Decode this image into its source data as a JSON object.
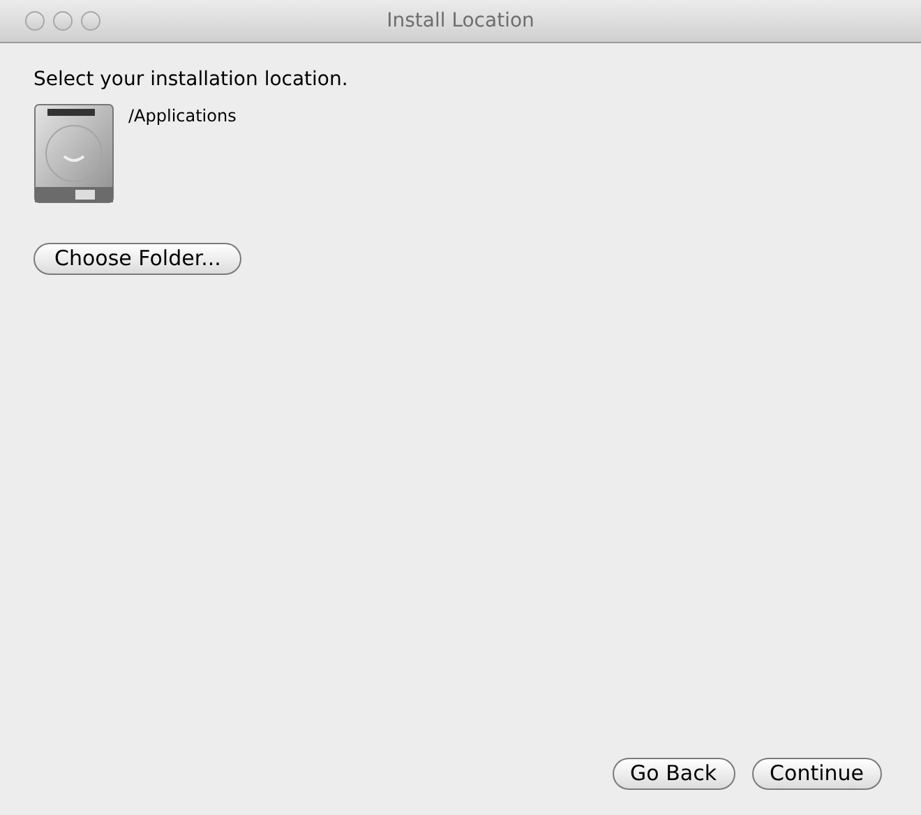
{
  "window": {
    "title": "Install Location"
  },
  "prompt": "Select your installation location.",
  "location": {
    "path": "/Applications"
  },
  "choose_button": "Choose Folder...",
  "buttons": [
    "Go Back",
    "Continue"
  ]
}
